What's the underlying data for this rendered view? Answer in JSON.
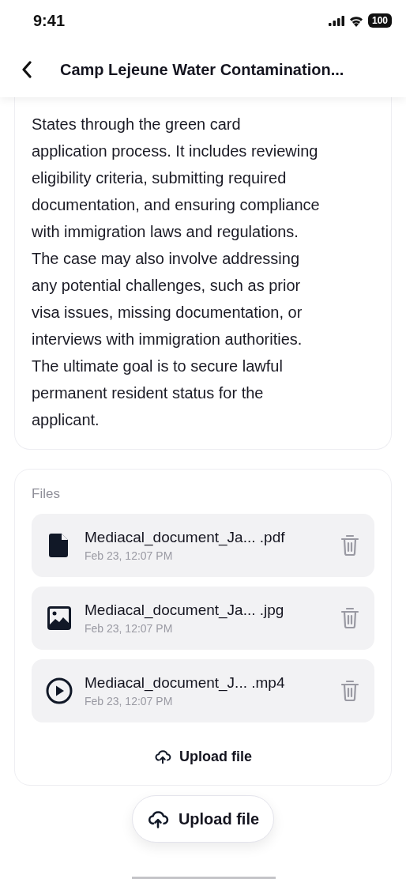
{
  "status_bar": {
    "time": "9:41",
    "battery": "100"
  },
  "header": {
    "title": "Camp Lejeune Water Contamination..."
  },
  "description": "States through the green card\napplication process. It includes reviewing\neligibility criteria, submitting required\ndocumentation, and ensuring compliance\nwith immigration laws and regulations.\nThe case may also involve addressing\nany potential challenges, such as prior\nvisa issues, missing documentation, or\ninterviews with immigration authorities.\nThe ultimate goal is to secure lawful\npermanent resident status for the\napplicant.",
  "files": {
    "label": "Files",
    "items": [
      {
        "kind": "document",
        "name": "Mediacal_document_Ja... .pdf",
        "date": "Feb 23, 12:07 PM"
      },
      {
        "kind": "image",
        "name": "Mediacal_document_Ja... .jpg",
        "date": "Feb 23, 12:07 PM"
      },
      {
        "kind": "video",
        "name": "Mediacal_document_J... .mp4",
        "date": "Feb 23, 12:07 PM"
      }
    ],
    "upload": "Upload file"
  },
  "upload_button": "Upload file"
}
